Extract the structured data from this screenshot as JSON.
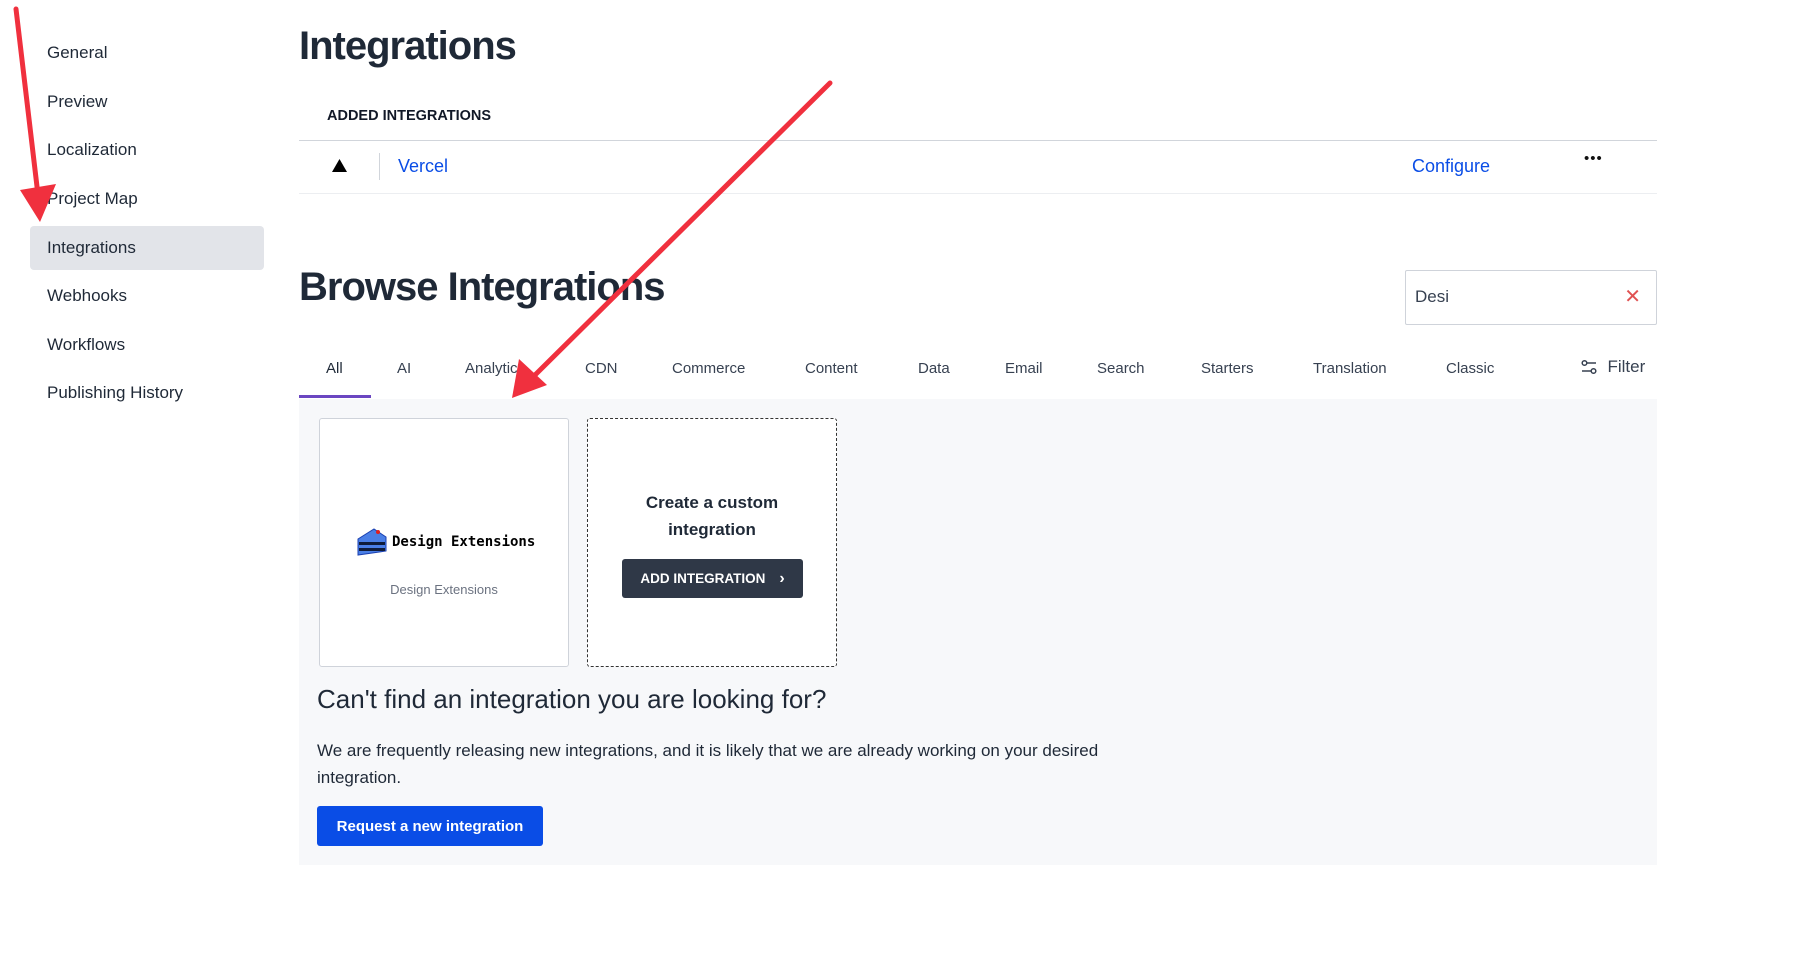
{
  "sidebar": {
    "items": [
      {
        "label": "General"
      },
      {
        "label": "Preview"
      },
      {
        "label": "Localization"
      },
      {
        "label": "Project Map"
      },
      {
        "label": "Integrations",
        "active": true
      },
      {
        "label": "Webhooks"
      },
      {
        "label": "Workflows"
      },
      {
        "label": "Publishing History"
      }
    ]
  },
  "header": {
    "title": "Integrations"
  },
  "added": {
    "label": "ADDED INTEGRATIONS",
    "items": [
      {
        "name": "Vercel",
        "icon": "vercel-triangle-icon",
        "action": "Configure",
        "more": "•••"
      }
    ]
  },
  "browse": {
    "title": "Browse Integrations",
    "search": {
      "value": "Desi"
    },
    "tabs": [
      {
        "label": "All",
        "active": true
      },
      {
        "label": "AI"
      },
      {
        "label": "Analytics"
      },
      {
        "label": "CDN"
      },
      {
        "label": "Commerce"
      },
      {
        "label": "Content"
      },
      {
        "label": "Data"
      },
      {
        "label": "Email"
      },
      {
        "label": "Search"
      },
      {
        "label": "Starters"
      },
      {
        "label": "Translation"
      },
      {
        "label": "Classic"
      }
    ],
    "filter_label": "Filter",
    "cards": [
      {
        "logo_text": "Design Extensions",
        "name": "Design Extensions"
      }
    ],
    "custom": {
      "title": "Create a custom integration",
      "button": "ADD INTEGRATION"
    },
    "notfound": {
      "heading": "Can't find an integration you are looking for?",
      "body": "We are frequently releasing new integrations, and it is likely that we are already working on your desired integration.",
      "button": "Request a new integration"
    }
  },
  "colors": {
    "accent": "#0a4de6",
    "tab_underline": "#6b46c1",
    "annotation_arrow": "#f0303e",
    "dark_button": "#2f3847"
  }
}
